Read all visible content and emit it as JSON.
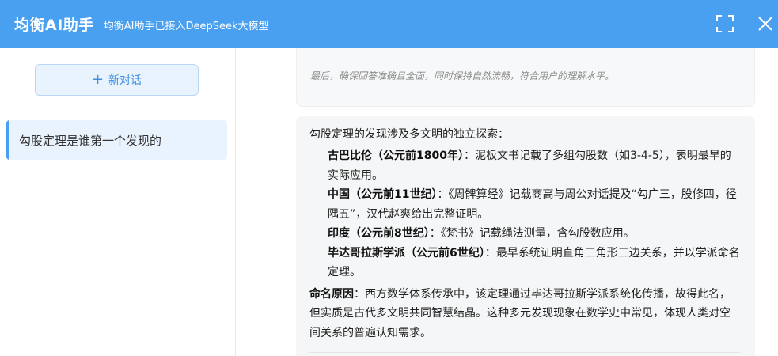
{
  "header": {
    "title": "均衡AI助手",
    "subtitle": "均衡AI助手已接入DeepSeek大模型",
    "fullscreen_icon": "fullscreen-icon",
    "close_icon": "close-icon",
    "bg_color": "#4aa0f0"
  },
  "sidebar": {
    "new_chat_label": "新对话",
    "new_chat_icon": "plus-icon",
    "conversations": [
      {
        "title": "勾股定理是谁第一个发现的"
      }
    ]
  },
  "chat": {
    "thinking_text": "最后，确保回答准确且全面，同时保持自然流畅，符合用户的理解水平。",
    "answer": {
      "intro": "勾股定理的发现涉及多文明的独立探索：",
      "items": [
        {
          "label": "古巴比伦（公元前1800年）",
          "text": "：泥板文书记载了多组勾股数（如3-4-5），表明最早的实际应用。"
        },
        {
          "label": "中国（公元前11世纪）",
          "text": "：《周髀算经》记载商高与周公对话提及“勾广三，股修四，径隅五”，汉代赵爽给出完整证明。"
        },
        {
          "label": "印度（公元前8世纪）",
          "text": "：《梵书》记载绳法测量，含勾股数应用。"
        },
        {
          "label": "毕达哥拉斯学派（公元前6世纪）",
          "text": "：最早系统证明直角三角形三边关系，并以学派命名定理。"
        }
      ],
      "naming_label": "命名原因",
      "naming_text": "：西方数学体系传承中，该定理通过毕达哥拉斯学派系统化传播，故得此名，但实质是古代多文明共同智慧结晶。这种多元发现现象在数学史中常见，体现人类对空间关系的普遍认知需求。"
    }
  }
}
